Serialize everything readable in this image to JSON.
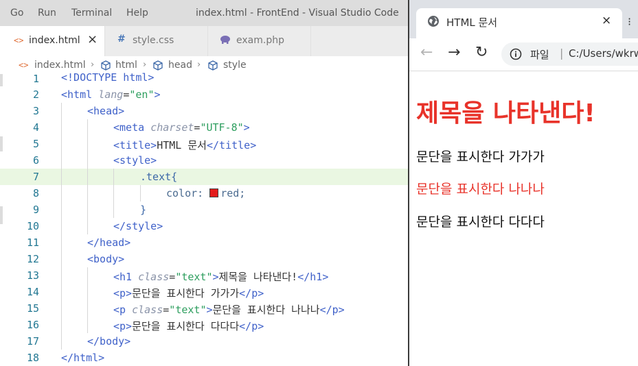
{
  "vscode": {
    "menu": [
      "Go",
      "Run",
      "Terminal",
      "Help"
    ],
    "window_title": "index.html - FrontEnd - Visual Studio Code",
    "tabs": [
      {
        "icon": "<>",
        "label": "index.html",
        "close": "×"
      },
      {
        "icon": "#",
        "label": "style.css"
      },
      {
        "icon": "php",
        "label": "exam.php"
      }
    ],
    "breadcrumb": [
      "index.html",
      "html",
      "head",
      "style"
    ],
    "line_numbers": [
      "1",
      "2",
      "3",
      "4",
      "5",
      "6",
      "7",
      "8",
      "9",
      "10",
      "11",
      "12",
      "13",
      "14",
      "15",
      "16",
      "17",
      "18"
    ],
    "code": {
      "doctype": "<!DOCTYPE html>",
      "html_lang": "en",
      "meta_charset": "UTF-8",
      "title_text": "HTML 문서",
      "css_selector": ".text{",
      "css_prop": "color:",
      "css_value": "red;",
      "css_close": "}",
      "h1_class": "text",
      "h1_text": "제목을 나타낸다!",
      "p1_text": "문단을 표시한다 가가가",
      "p2_class": "text",
      "p2_text": "문단을 표시한다 나나나",
      "p3_text": "문단을 표시한다 다다다"
    },
    "colors": {
      "red_swatch": "#e31b1b",
      "current_line": "#eaf7e2"
    }
  },
  "browser": {
    "tab_title": "HTML 문서",
    "tab_close": "×",
    "scheme_label": "파일",
    "url": "C:/Users/wkrw",
    "page": {
      "h1": "제목을 나타낸다!",
      "p1": "문단을 표시한다 가가가",
      "p2": "문단을 표시한다 나나나",
      "p3": "문단을 표시한다 다다다"
    },
    "colors": {
      "heading_red": "#e8332a",
      "text_red": "#e8332a"
    }
  }
}
